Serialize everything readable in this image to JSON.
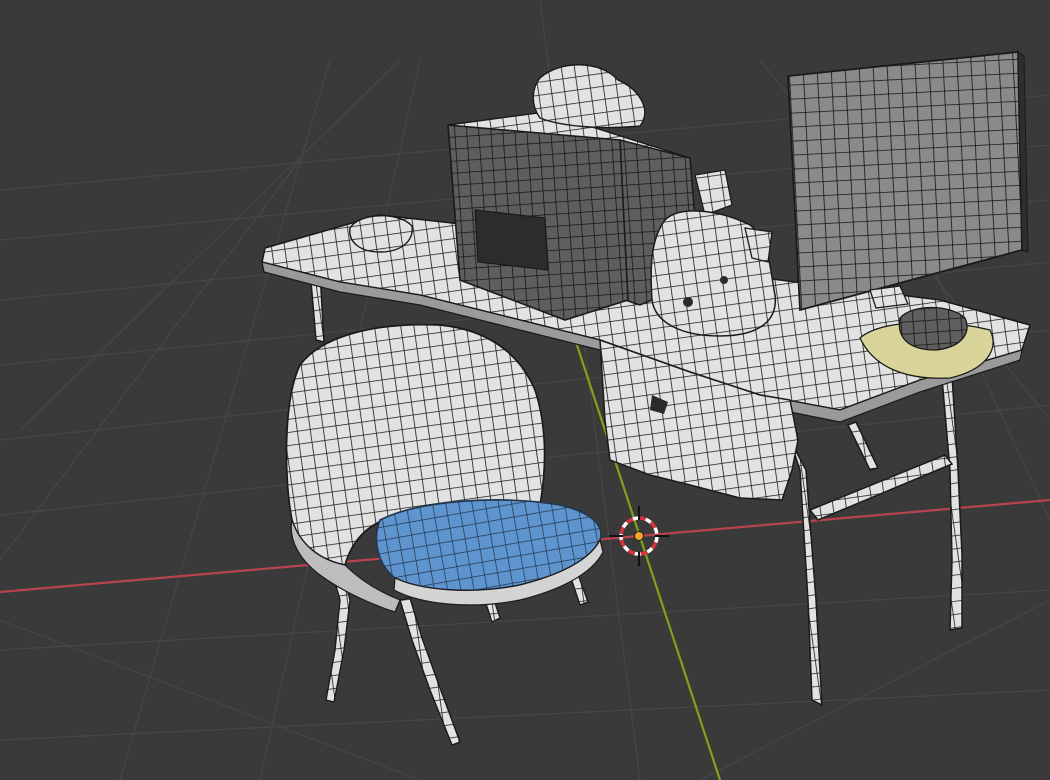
{
  "viewport": {
    "background_color": "#3a3a3a",
    "grid_color": "#4a4a4a",
    "x_axis_color": "#b6434e",
    "y_axis_color": "#7ea21c",
    "mesh_fill_color": "#e4e4e4",
    "mesh_dark_fill_color": "#6a6a6a",
    "wire_color": "#1b1b1b",
    "selected_face_color": "#5b93cc",
    "origin_color": "#f5a623"
  },
  "scene": {
    "objects": [
      "chair",
      "desk",
      "computer-tower",
      "monitor",
      "plush-toy",
      "keyboard-pad"
    ],
    "selected_part": "chair-seat"
  },
  "cursor_icon": "3d-cursor-icon"
}
